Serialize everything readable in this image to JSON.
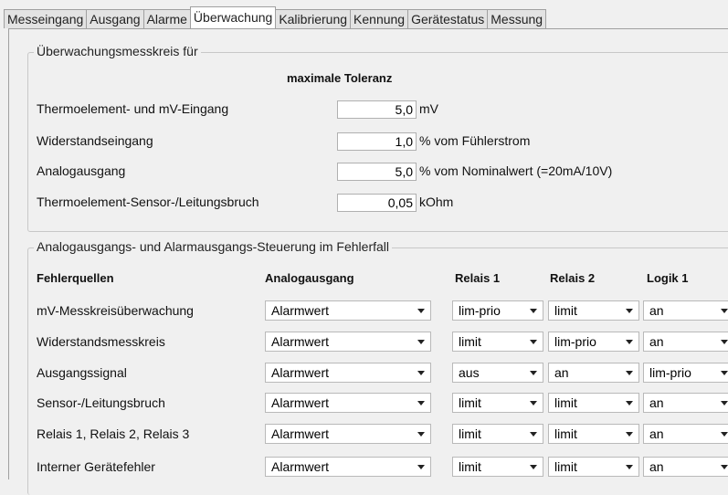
{
  "tabs": [
    "Messeingang",
    "Ausgang",
    "Alarme",
    "Überwachung",
    "Kalibrierung",
    "Kennung",
    "Gerätestatus",
    "Messung"
  ],
  "active_tab": "Überwachung",
  "monitoring": {
    "legend": "Überwachungsmesskreis für",
    "column_header": "maximale Toleranz",
    "rows": [
      {
        "label": "Thermoelement- und mV-Eingang",
        "value": "5,0",
        "unit": "mV"
      },
      {
        "label": "Widerstandseingang",
        "value": "1,0",
        "unit": "% vom Fühlerstrom"
      },
      {
        "label": "Analogausgang",
        "value": "5,0",
        "unit": "% vom Nominalwert (=20mA/10V)"
      },
      {
        "label": "Thermoelement-Sensor-/Leitungsbruch",
        "value": "0,05",
        "unit": "kOhm"
      }
    ]
  },
  "error_control": {
    "legend": "Analogausgangs- und Alarmausgangs-Steuerung im Fehlerfall",
    "headers": [
      "Fehlerquellen",
      "Analogausgang",
      "Relais 1",
      "Relais 2",
      "Logik 1"
    ],
    "rows": [
      {
        "source": "mV-Messkreisüberwachung",
        "analog": "Alarmwert",
        "relais1": "lim-prio",
        "relais2": "limit",
        "logik1": "an"
      },
      {
        "source": "Widerstandsmesskreis",
        "analog": "Alarmwert",
        "relais1": "limit",
        "relais2": "lim-prio",
        "logik1": "an"
      },
      {
        "source": "Ausgangssignal",
        "analog": "Alarmwert",
        "relais1": "aus",
        "relais2": "an",
        "logik1": "lim-prio"
      },
      {
        "source": "Sensor-/Leitungsbruch",
        "analog": "Alarmwert",
        "relais1": "limit",
        "relais2": "limit",
        "logik1": "an"
      },
      {
        "source": "Relais 1, Relais 2, Relais 3",
        "analog": "Alarmwert",
        "relais1": "limit",
        "relais2": "limit",
        "logik1": "an"
      },
      {
        "source": "Interner Gerätefehler",
        "analog": "Alarmwert",
        "relais1": "limit",
        "relais2": "limit",
        "logik1": "an"
      }
    ]
  }
}
